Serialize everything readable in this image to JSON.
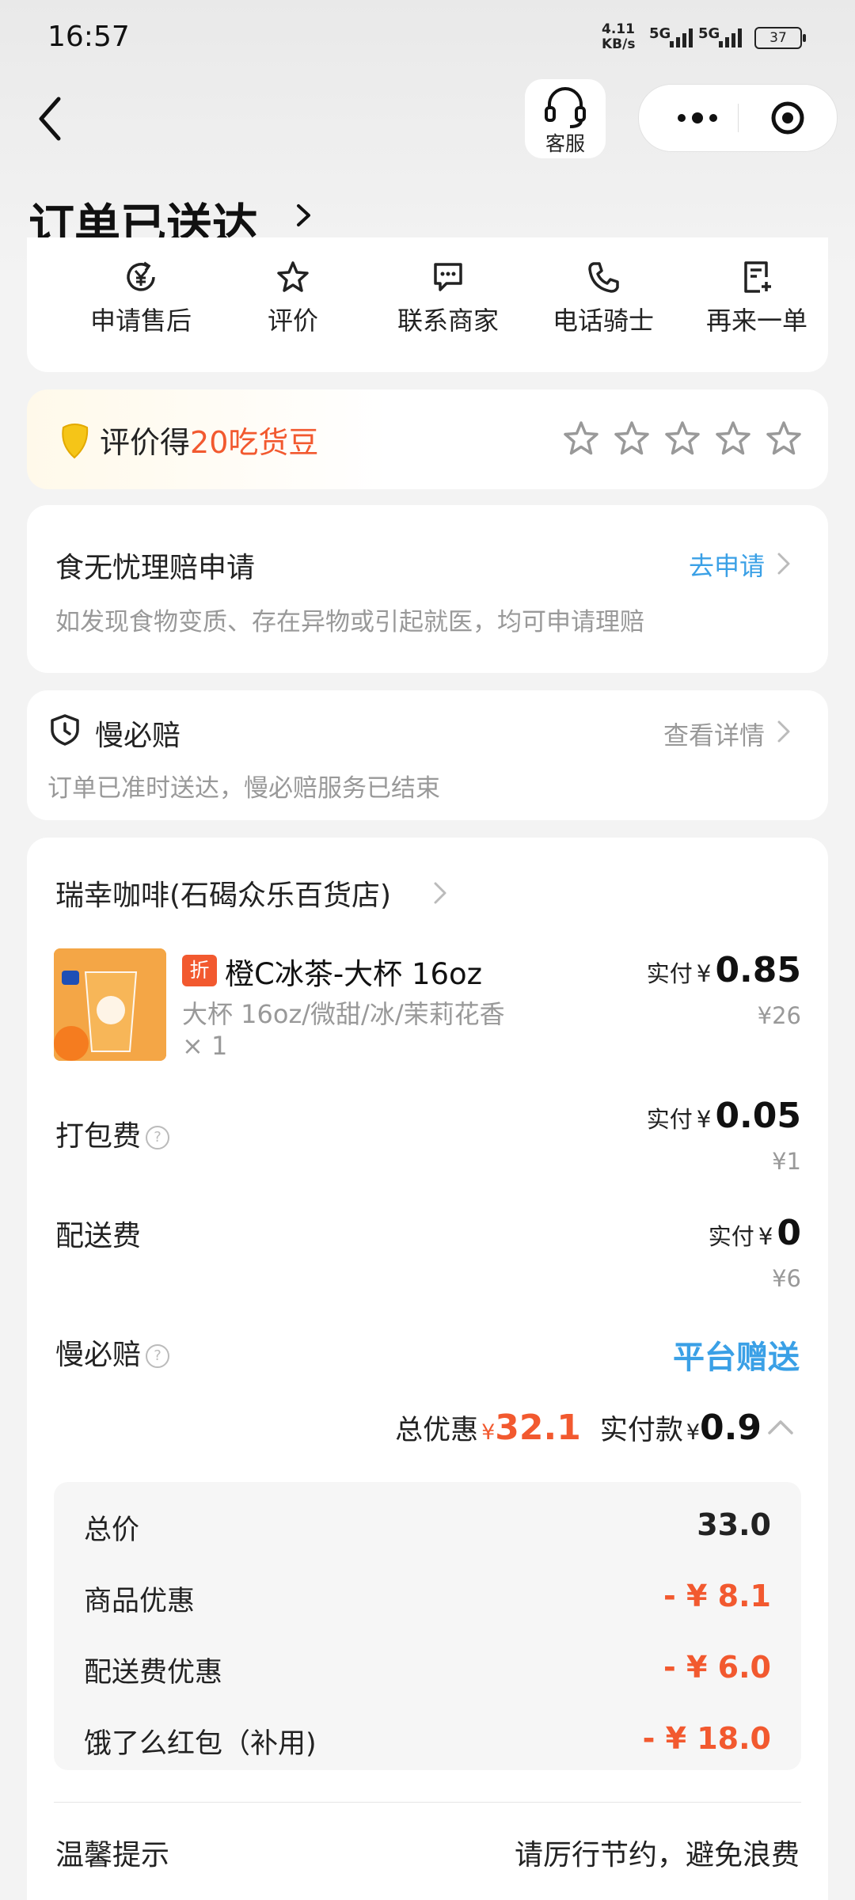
{
  "status_bar": {
    "time": "16:57",
    "net_speed_value": "4.11",
    "net_speed_unit": "KB/s",
    "signal1": "5G",
    "signal2": "5G",
    "battery": "37"
  },
  "header": {
    "customer_service_label": "客服",
    "title": "订单已送达"
  },
  "actions": [
    {
      "label": "申请售后",
      "icon": "yuan-refund-icon"
    },
    {
      "label": "评价",
      "icon": "star-icon"
    },
    {
      "label": "联系商家",
      "icon": "chat-icon"
    },
    {
      "label": "电话骑士",
      "icon": "phone-icon"
    },
    {
      "label": "再来一单",
      "icon": "reorder-icon"
    }
  ],
  "rating": {
    "prefix": "评价得",
    "reward": "20吃货豆"
  },
  "claim": {
    "title": "食无忧理赔申请",
    "link": "去申请",
    "desc": "如发现食物变质、存在异物或引起就医，均可申请理赔"
  },
  "slow_pay": {
    "title": "慢必赔",
    "link": "查看详情",
    "desc": "订单已准时送达，慢必赔服务已结束"
  },
  "order": {
    "store": "瑞幸咖啡(石碣众乐百货店)",
    "item": {
      "badge": "折",
      "name": "橙C冰茶-大杯 16oz",
      "spec": "大杯 16oz/微甜/冰/茉莉花香",
      "qty": "× 1",
      "paid_prefix": "实付",
      "currency": "¥",
      "paid": "0.85",
      "original": "¥26"
    },
    "packing": {
      "label": "打包费",
      "paid_prefix": "实付",
      "currency": "¥",
      "paid": "0.05",
      "original": "¥1"
    },
    "delivery": {
      "label": "配送费",
      "paid_prefix": "实付",
      "currency": "¥",
      "paid": "0",
      "original": "¥6"
    },
    "slow_pay": {
      "label": "慢必赔",
      "value": "平台赠送"
    },
    "summary": {
      "discount_label": "总优惠",
      "currency": "¥",
      "discount": "32.1",
      "paid_label": "实付款",
      "paid": "0.9"
    },
    "breakdown": [
      {
        "label": "总价",
        "value": "33.0"
      },
      {
        "label": "商品优惠",
        "value": "- ¥ 8.1"
      },
      {
        "label": "配送费优惠",
        "value": "- ¥ 6.0"
      },
      {
        "label": "饿了么红包（补用)",
        "value": "- ¥ 18.0"
      }
    ],
    "tip": {
      "label": "温馨提示",
      "text": "请厉行节约，避免浪费"
    }
  },
  "colors": {
    "accent_red": "#f2592f",
    "accent_blue": "#3aa0e6",
    "muted": "#999999"
  }
}
